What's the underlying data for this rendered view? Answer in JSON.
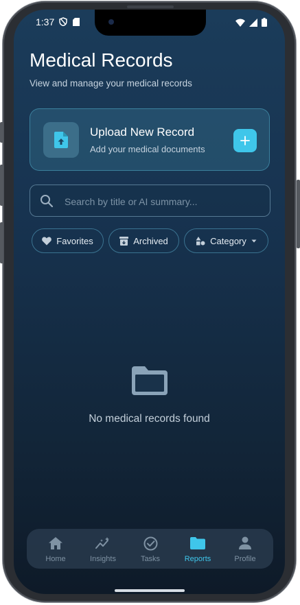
{
  "status_bar": {
    "time": "1:37"
  },
  "header": {
    "title": "Medical Records",
    "subtitle": "View and manage your medical records"
  },
  "upload": {
    "title": "Upload New Record",
    "subtitle": "Add your medical documents",
    "icon": "file-upload-icon",
    "action_icon": "plus-icon"
  },
  "search": {
    "placeholder": "Search by title or AI summary...",
    "value": ""
  },
  "filters": {
    "favorites": "Favorites",
    "archived": "Archived",
    "category": "Category"
  },
  "empty_state": {
    "message": "No medical records found",
    "icon": "folder-icon"
  },
  "tabs": [
    {
      "label": "Home",
      "icon": "home-icon",
      "active": false
    },
    {
      "label": "Insights",
      "icon": "insights-icon",
      "active": false
    },
    {
      "label": "Tasks",
      "icon": "check-circle-icon",
      "active": false
    },
    {
      "label": "Reports",
      "icon": "folder-icon",
      "active": true
    },
    {
      "label": "Profile",
      "icon": "person-icon",
      "active": false
    }
  ],
  "colors": {
    "accent": "#3fc6ea",
    "background_top": "#1b3c5a",
    "background_bottom": "#0e1a28",
    "inactive_tab": "#7f92a3"
  }
}
